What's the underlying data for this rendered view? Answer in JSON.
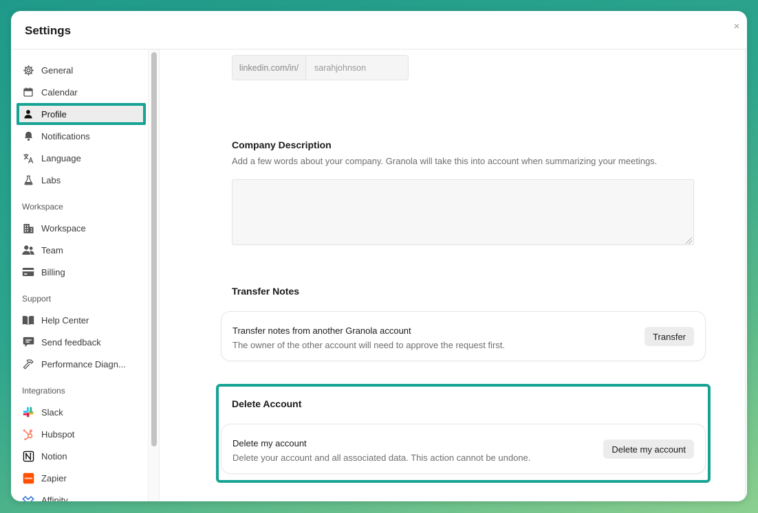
{
  "window": {
    "title": "Settings",
    "close_glyph": "×"
  },
  "sidebar": {
    "items_top": [
      {
        "label": "General",
        "icon": "gear-icon"
      },
      {
        "label": "Calendar",
        "icon": "calendar-icon"
      },
      {
        "label": "Profile",
        "icon": "person-icon",
        "active": true
      },
      {
        "label": "Notifications",
        "icon": "bell-icon"
      },
      {
        "label": "Language",
        "icon": "translate-icon"
      },
      {
        "label": "Labs",
        "icon": "flask-icon"
      }
    ],
    "workspace_label": "Workspace",
    "workspace_items": [
      {
        "label": "Workspace",
        "icon": "building-icon"
      },
      {
        "label": "Team",
        "icon": "team-icon"
      },
      {
        "label": "Billing",
        "icon": "card-icon"
      }
    ],
    "support_label": "Support",
    "support_items": [
      {
        "label": "Help Center",
        "icon": "book-icon"
      },
      {
        "label": "Send feedback",
        "icon": "chat-icon"
      },
      {
        "label": "Performance Diagn...",
        "icon": "hammer-icon"
      }
    ],
    "integrations_label": "Integrations",
    "integration_items": [
      {
        "label": "Slack",
        "icon": "slack-icon"
      },
      {
        "label": "Hubspot",
        "icon": "hubspot-icon"
      },
      {
        "label": "Notion",
        "icon": "notion-icon"
      },
      {
        "label": "Zapier",
        "icon": "zapier-icon"
      },
      {
        "label": "Affinity",
        "icon": "affinity-icon"
      }
    ]
  },
  "main": {
    "linkedin": {
      "prefix": "linkedin.com/in/",
      "value": "sarahjohnson"
    },
    "company": {
      "title": "Company Description",
      "description": "Add a few words about your company. Granola will take this into account when summarizing your meetings.",
      "value": ""
    },
    "transfer": {
      "title": "Transfer Notes",
      "card_title": "Transfer notes from another Granola account",
      "card_subtitle": "The owner of the other account will need to approve the request first.",
      "button": "Transfer"
    },
    "delete": {
      "title": "Delete Account",
      "card_title": "Delete my account",
      "card_subtitle": "Delete your account and all associated data. This action cannot be undone.",
      "button": "Delete my account"
    }
  },
  "colors": {
    "highlight": "#16a394",
    "background_gradient": [
      "#1f9a8a",
      "#8ccf8f"
    ]
  }
}
